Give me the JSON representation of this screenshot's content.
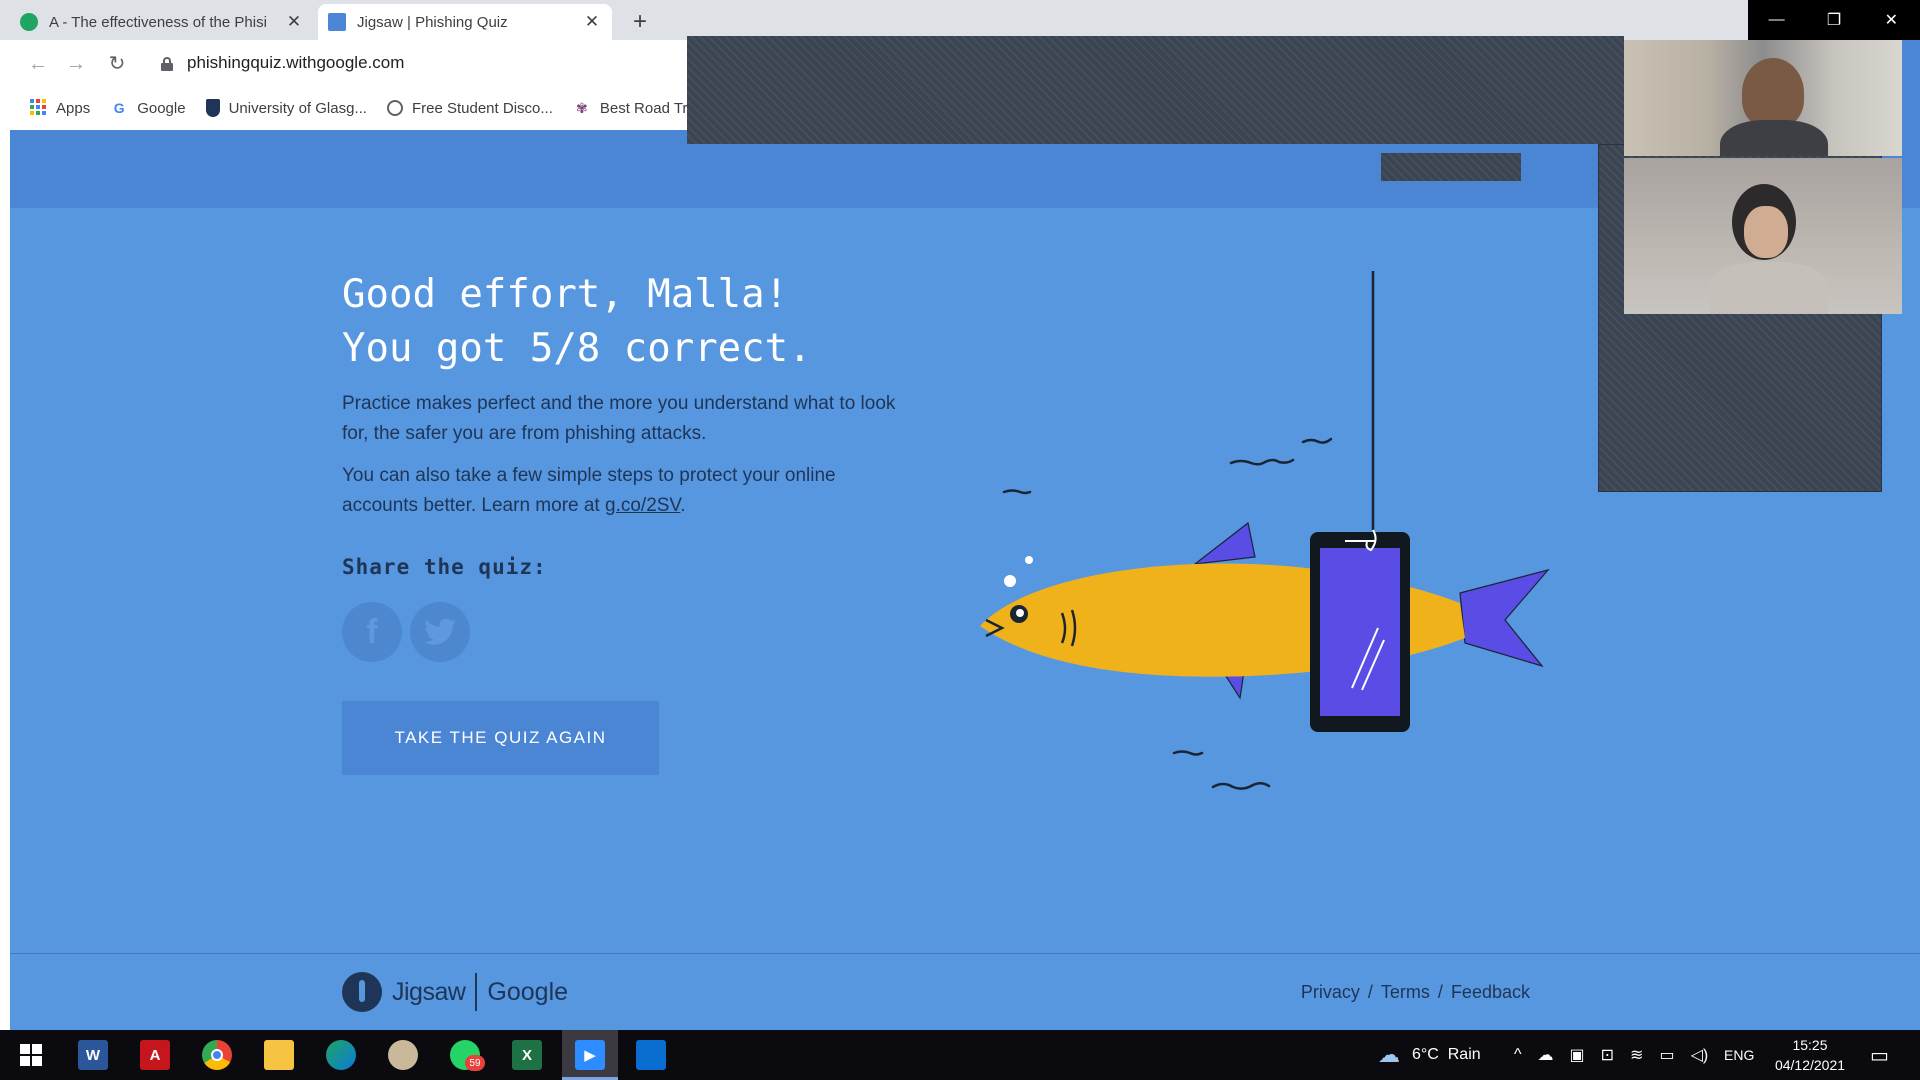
{
  "browser": {
    "tabs": [
      {
        "title": "A - The effectiveness of the Phisi",
        "active": false
      },
      {
        "title": "Jigsaw | Phishing Quiz",
        "active": true
      }
    ],
    "url": "phishingquiz.withgoogle.com",
    "bookmarks": [
      {
        "label": "Apps",
        "icon": "apps-grid-icon"
      },
      {
        "label": "Google",
        "icon": "google-g-icon"
      },
      {
        "label": "University of Glasg...",
        "icon": "university-crest-icon"
      },
      {
        "label": "Free Student Disco...",
        "icon": "globe-icon"
      },
      {
        "label": "Best Road Tri",
        "icon": "thistle-icon"
      }
    ]
  },
  "quiz": {
    "headline_line1": "Good effort, Malla!",
    "headline_line2": "You got 5/8 correct.",
    "paragraph1": "Practice makes perfect and the more you understand what to look for, the safer you are from phishing attacks.",
    "paragraph2_prefix": "You can also take a few simple steps to protect your online accounts better. Learn more at ",
    "paragraph2_link": "g.co/2SV",
    "paragraph2_suffix": ".",
    "share_label": "Share the quiz:",
    "facebook_glyph": "f",
    "retake_label": "TAKE THE QUIZ AGAIN"
  },
  "footer": {
    "brand_jigsaw": "Jigsaw",
    "brand_google": "Google",
    "links": [
      "Privacy",
      "Terms",
      "Feedback"
    ],
    "separator": "/"
  },
  "taskbar": {
    "weather": "6°C  Rain",
    "language": "ENG",
    "time": "15:25",
    "date": "04/12/2021",
    "whatsapp_badge": "59"
  },
  "colors": {
    "page_bg": "#5697e0",
    "header_bg": "#4a86d4",
    "text_dark": "#1f3557",
    "fish": "#f0b21b",
    "phone_screen": "#5a4de6"
  }
}
